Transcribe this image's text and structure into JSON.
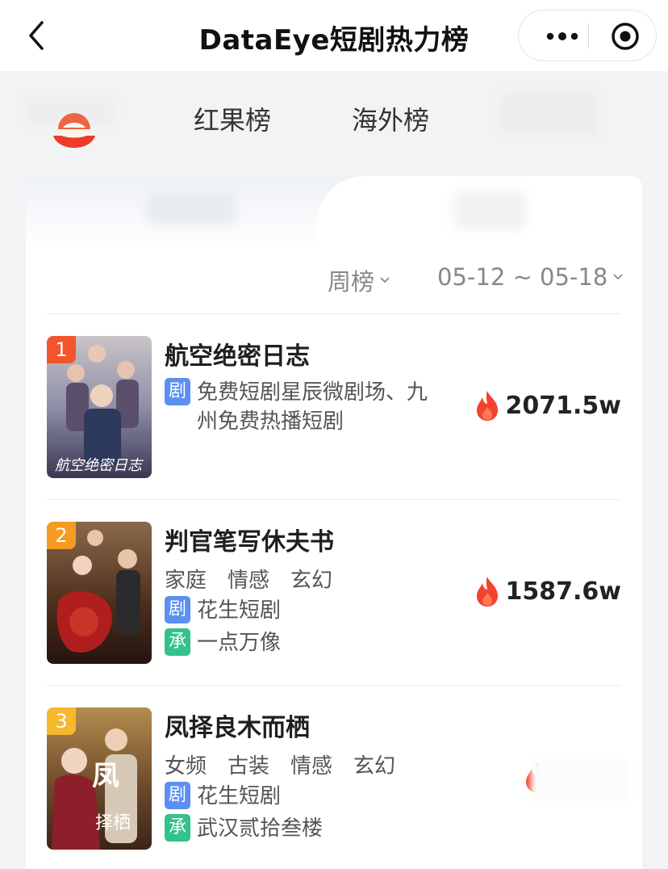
{
  "nav": {
    "title": "DataEye短剧热力榜",
    "back_icon": "chevron-left-icon",
    "more_icon": "more-dots-icon",
    "target_icon": "target-icon"
  },
  "tabs": [
    {
      "label": "红果榜"
    },
    {
      "label": "海外榜"
    }
  ],
  "filters": {
    "period": "周榜",
    "date_range": "05-12 ~ 05-18"
  },
  "rows": [
    {
      "rank": "1",
      "title": "航空绝密日志",
      "tags": [],
      "platform": "免费短剧星辰微剧场、九州免费热播短剧",
      "producer": "",
      "heat": "2071.5w",
      "badge_color": "#f2552c"
    },
    {
      "rank": "2",
      "title": "判官笔写休夫书",
      "tags": [
        "家庭",
        "情感",
        "玄幻"
      ],
      "platform": "花生短剧",
      "producer": "一点万像",
      "heat": "1587.6w",
      "badge_color": "#f59a23"
    },
    {
      "rank": "3",
      "title": "凤择良木而栖",
      "tags": [
        "女频",
        "古装",
        "情感",
        "玄幻"
      ],
      "platform": "花生短剧",
      "producer": "武汉贰拾叁楼",
      "heat": "",
      "badge_color": "#f5b82e"
    }
  ],
  "chips": {
    "ju": "剧",
    "cheng": "承"
  },
  "colors": {
    "fire": "#f2432d",
    "chip_ju": "#5b8ff2",
    "chip_cheng": "#33c28b"
  }
}
